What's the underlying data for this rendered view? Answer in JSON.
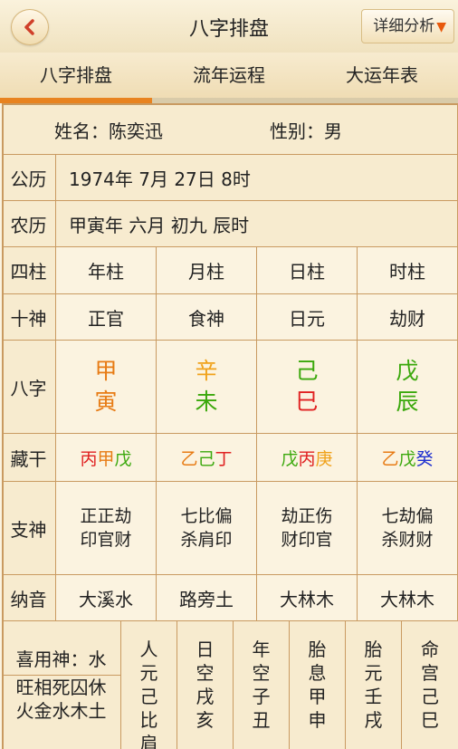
{
  "header": {
    "title": "八字排盘",
    "detail_button": "详细分析",
    "detail_arrow": "▼"
  },
  "tabs": [
    "八字排盘",
    "流年运程",
    "大运年表"
  ],
  "person": {
    "name_label": "姓名：陈奕迅",
    "gender_label": "性别：男"
  },
  "calendar": {
    "solar_label": "公历",
    "solar_value": "1974年 7月 27日 8时",
    "lunar_label": "农历",
    "lunar_value": "甲寅年 六月 初九 辰时"
  },
  "pillars": {
    "label": "四柱",
    "headers": [
      "年柱",
      "月柱",
      "日柱",
      "时柱"
    ]
  },
  "shishen": {
    "label": "十神",
    "values": [
      "正官",
      "食神",
      "日元",
      "劫财"
    ]
  },
  "bazi": {
    "label": "八字",
    "stems": [
      {
        "char": "甲",
        "color": "#e77b14"
      },
      {
        "char": "辛",
        "color": "#f0a21b"
      },
      {
        "char": "己",
        "color": "#3aa80c"
      },
      {
        "char": "戊",
        "color": "#3aa80c"
      }
    ],
    "branches": [
      {
        "char": "寅",
        "color": "#e77b14"
      },
      {
        "char": "未",
        "color": "#3aa80c"
      },
      {
        "char": "巳",
        "color": "#e02222"
      },
      {
        "char": "辰",
        "color": "#3aa80c"
      }
    ]
  },
  "canggan": {
    "label": "藏干",
    "cells": [
      [
        {
          "char": "丙",
          "color": "#e02222"
        },
        {
          "char": "甲",
          "color": "#e77b14"
        },
        {
          "char": "戊",
          "color": "#3aa80c"
        }
      ],
      [
        {
          "char": "乙",
          "color": "#e77b14"
        },
        {
          "char": "己",
          "color": "#3aa80c"
        },
        {
          "char": "丁",
          "color": "#e02222"
        }
      ],
      [
        {
          "char": "戊",
          "color": "#3aa80c"
        },
        {
          "char": "丙",
          "color": "#e02222"
        },
        {
          "char": "庚",
          "color": "#f0a21b"
        }
      ],
      [
        {
          "char": "乙",
          "color": "#e77b14"
        },
        {
          "char": "戊",
          "color": "#3aa80c"
        },
        {
          "char": "癸",
          "color": "#1d2fd0"
        }
      ]
    ]
  },
  "zhishen": {
    "label": "支神",
    "cells": [
      [
        "正正劫",
        "印官财"
      ],
      [
        "七比偏",
        "杀肩印"
      ],
      [
        "劫正伤",
        "财印官"
      ],
      [
        "七劫偏",
        "杀财财"
      ]
    ]
  },
  "nayin": {
    "label": "纳音",
    "values": [
      "大溪水",
      "路旁土",
      "大林木",
      "大林木"
    ]
  },
  "bottom": {
    "xiyong": "喜用神：水",
    "wangxiang": [
      "旺相死囚休",
      "火金水木土"
    ],
    "columns": [
      "人元己比肩",
      "日空戌亥",
      "年空子丑",
      "胎息甲申",
      "胎元壬戌",
      "命宫己巳"
    ]
  }
}
